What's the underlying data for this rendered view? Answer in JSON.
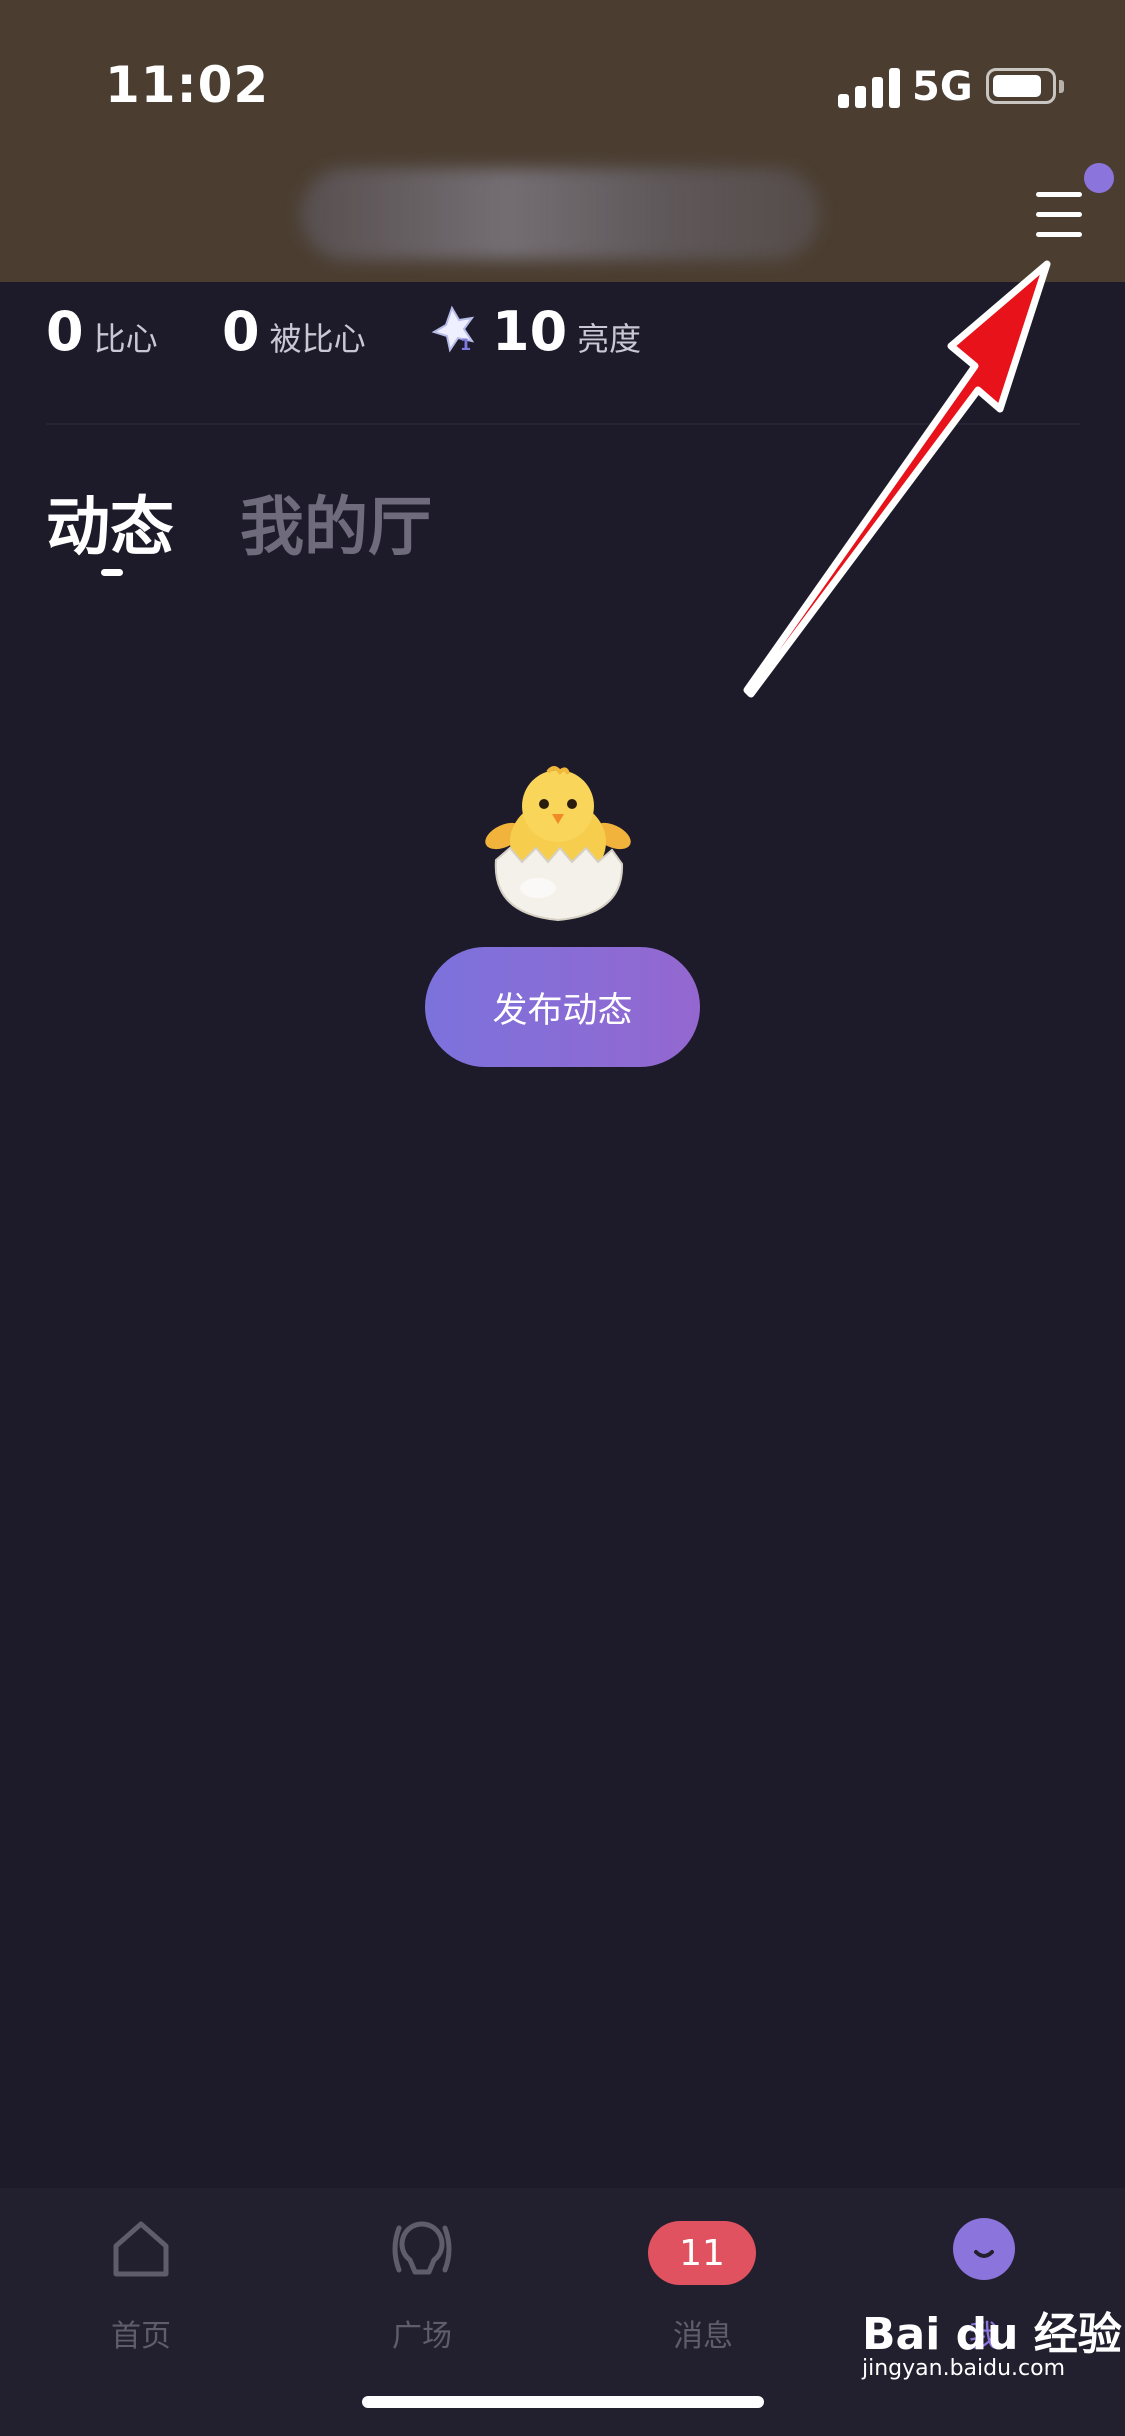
{
  "status_bar": {
    "time": "11:02",
    "network": "5G",
    "battery_level": 0.8
  },
  "header": {
    "title_blurred": true,
    "menu_icon": "hamburger-menu-icon",
    "has_notification_dot": true
  },
  "stats": [
    {
      "value": "0",
      "label": "比心"
    },
    {
      "value": "0",
      "label": "被比心"
    },
    {
      "value": "10",
      "label": "亮度",
      "icon": "star-level-icon"
    }
  ],
  "tabs": [
    {
      "label": "动态",
      "active": true
    },
    {
      "label": "我的厅",
      "active": false
    }
  ],
  "empty_state": {
    "illustration": "hatching-chick-icon",
    "button_label": "发布动态"
  },
  "bottom_nav": [
    {
      "label": "首页",
      "icon": "home-icon",
      "active": false
    },
    {
      "label": "广场",
      "icon": "square-icon",
      "active": false
    },
    {
      "label": "消息",
      "icon": "message-icon",
      "badge": "11",
      "active": false
    },
    {
      "label": "我",
      "icon": "me-avatar-icon",
      "active": true
    }
  ],
  "watermark": {
    "brand": "Bai du 经验",
    "url": "jingyan.baidu.com"
  },
  "colors": {
    "background": "#1d1b29",
    "header": "#4b3e31",
    "accent": "#8c74dd",
    "badge": "#e0525f",
    "annotation_arrow": "#e8121b"
  }
}
